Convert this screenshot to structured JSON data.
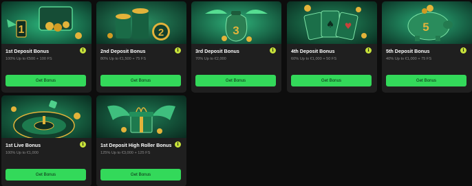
{
  "bonuses": [
    {
      "title": "1st Deposit Bonus",
      "subtitle": "100% Up to €500 + 100 FS",
      "button": "Get Bonus",
      "info": "i",
      "art": "numbers-one-icon"
    },
    {
      "title": "2nd Deposit Bonus",
      "subtitle": "80% Up to €1,500 + 75 FS",
      "button": "Get Bonus",
      "info": "i",
      "art": "coin-stacks-two-icon"
    },
    {
      "title": "3rd Deposit Bonus",
      "subtitle": "70% Up to €2,000",
      "button": "Get Bonus",
      "info": "i",
      "art": "money-bag-three-icon"
    },
    {
      "title": "4th Deposit Bonus",
      "subtitle": "60% Up to €1,000 + 50 FS",
      "button": "Get Bonus",
      "info": "i",
      "art": "playing-cards-icon"
    },
    {
      "title": "5th Deposit Bonus",
      "subtitle": "40% Up to €1,000 + 75 FS",
      "button": "Get Bonus",
      "info": "i",
      "art": "piggy-bank-five-icon"
    },
    {
      "title": "1st Live Bonus",
      "subtitle": "100% Up to €1,000",
      "button": "Get Bonus",
      "info": "i",
      "art": "roulette-wheel-icon"
    },
    {
      "title": "1st Deposit High Roller Bonus",
      "subtitle": "125% Up to €3,000 + 125 FS",
      "button": "Get Bonus",
      "info": "i",
      "art": "winged-gift-icon"
    }
  ],
  "colors": {
    "page_bg": "#0d0d0d",
    "card_bg": "#1f1f1f",
    "button_bg": "#33d95a",
    "info_badge": "#c7e23a",
    "art_green": "#1f9e63",
    "coin_gold": "#e3b33a"
  }
}
